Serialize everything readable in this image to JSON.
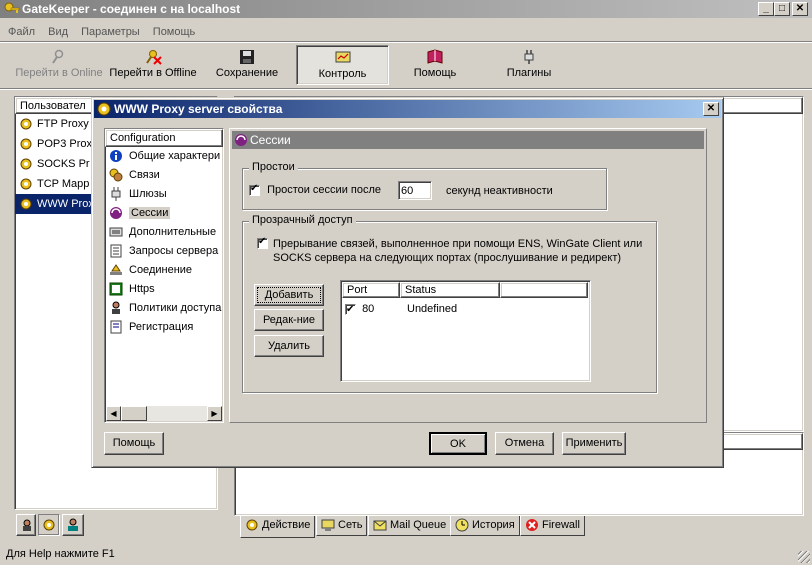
{
  "app": {
    "title": "GateKeeper - соединен с на localhost",
    "status": "Для Help нажмите F1"
  },
  "menu": [
    "Файл",
    "Вид",
    "Параметры",
    "Помощь"
  ],
  "toolbar": [
    {
      "label": "Перейти в Online",
      "icon": "key-icon",
      "disabled": true
    },
    {
      "label": "Перейти в Offline",
      "icon": "key-cross-icon",
      "disabled": false
    },
    {
      "label": "Сохранение",
      "icon": "floppy-icon",
      "disabled": false
    },
    {
      "label": "Контроль",
      "icon": "monitor-icon",
      "disabled": false,
      "pressed": true
    },
    {
      "label": "Помощь",
      "icon": "book-icon",
      "disabled": false
    },
    {
      "label": "Плагины",
      "icon": "plug-icon",
      "disabled": false
    }
  ],
  "left_panel": {
    "header": "Пользовател",
    "items": [
      "FTP Proxy",
      "POP3 Proxy",
      "SOCKS Pr",
      "TCP Mapp",
      "WWW Proxy"
    ],
    "selected_index": 4
  },
  "bottom_tabs": [
    "Действие",
    "Сеть",
    "Mail Queue",
    "История",
    "Firewall"
  ],
  "dialog": {
    "title": "WWW Proxy server свойства",
    "tree_header": "Configuration",
    "tree": [
      {
        "label": "Общие характери",
        "icon": "info-icon"
      },
      {
        "label": "Связи",
        "icon": "links-icon"
      },
      {
        "label": "Шлюзы",
        "icon": "gateway-icon"
      },
      {
        "label": "Сессии",
        "icon": "sessions-icon",
        "selected": true
      },
      {
        "label": "Дополнительные",
        "icon": "extra-icon"
      },
      {
        "label": "Запросы сервера",
        "icon": "server-requests-icon"
      },
      {
        "label": "Соединение",
        "icon": "connection-icon"
      },
      {
        "label": "Https",
        "icon": "https-icon"
      },
      {
        "label": "Политики доступа",
        "icon": "policy-icon"
      },
      {
        "label": "Регистрация",
        "icon": "log-icon"
      }
    ],
    "panel_title": "Сессии",
    "idle": {
      "legend": "Простои",
      "checkbox_label": "Простои сессии после",
      "value": "60",
      "suffix": "секунд неактивности"
    },
    "transparent": {
      "legend": "Прозрачный доступ",
      "checkbox_label_line1": "Прерывание связей, выполненное при помощи ENS, WinGate Client или",
      "checkbox_label_line2": "SOCKS сервера на следующих портах (прослушивание и редирект)",
      "buttons": [
        "Добавить",
        "Редак-ние",
        "Удалить"
      ],
      "columns": [
        "Port",
        "Status"
      ],
      "rows": [
        {
          "port": "80",
          "status": "Undefined",
          "checked": true
        }
      ]
    },
    "buttons": {
      "help": "Помощь",
      "ok": "OK",
      "cancel": "Отмена",
      "apply": "Применить"
    }
  },
  "colors": {
    "face": "#d4d0c8",
    "active_title": "#0a246a",
    "inactive_title": "#808080",
    "selection": "#0a246a"
  }
}
